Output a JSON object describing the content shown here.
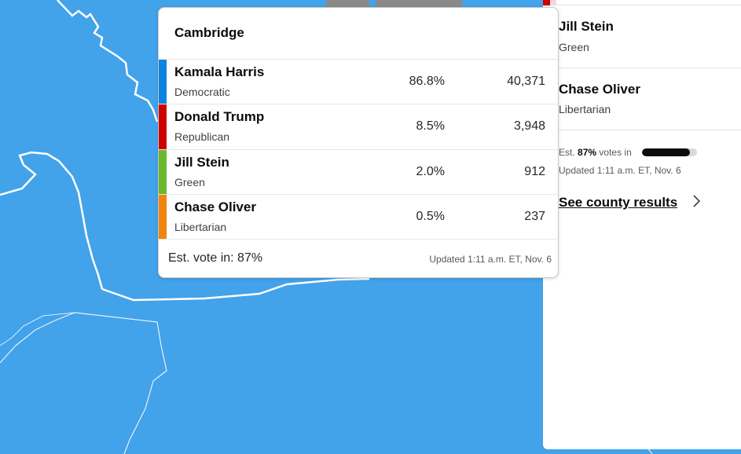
{
  "map": {
    "water_color": "#42a2ea",
    "boundary_color": "#ffffff",
    "gray_county_color": "#8a8a8a"
  },
  "tooltip": {
    "title": "Cambridge",
    "candidates": [
      {
        "name": "Kamala Harris",
        "party": "Democratic",
        "pct": "86.8%",
        "votes": "40,371",
        "color": "#0b84e0"
      },
      {
        "name": "Donald Trump",
        "party": "Republican",
        "pct": "8.5%",
        "votes": "3,948",
        "color": "#cc0000"
      },
      {
        "name": "Jill Stein",
        "party": "Green",
        "pct": "2.0%",
        "votes": "912",
        "color": "#6ab82e"
      },
      {
        "name": "Chase Oliver",
        "party": "Libertarian",
        "pct": "0.5%",
        "votes": "237",
        "color": "#f0850d"
      }
    ],
    "est_vote": "Est. vote in: 87%",
    "updated": "Updated 1:11 a.m. ET, Nov. 6"
  },
  "panel": {
    "candidates": [
      {
        "name": "Jill Stein",
        "party": "Green"
      },
      {
        "name": "Chase Oliver",
        "party": "Libertarian"
      }
    ],
    "est_prefix": "Est.",
    "est_pct": "87%",
    "est_suffix": "votes in",
    "est_fraction": 0.87,
    "updated": "Updated 1:11 a.m. ET, Nov. 6",
    "county_link": "See county results",
    "chevron_icon": "chevron-right-icon"
  }
}
